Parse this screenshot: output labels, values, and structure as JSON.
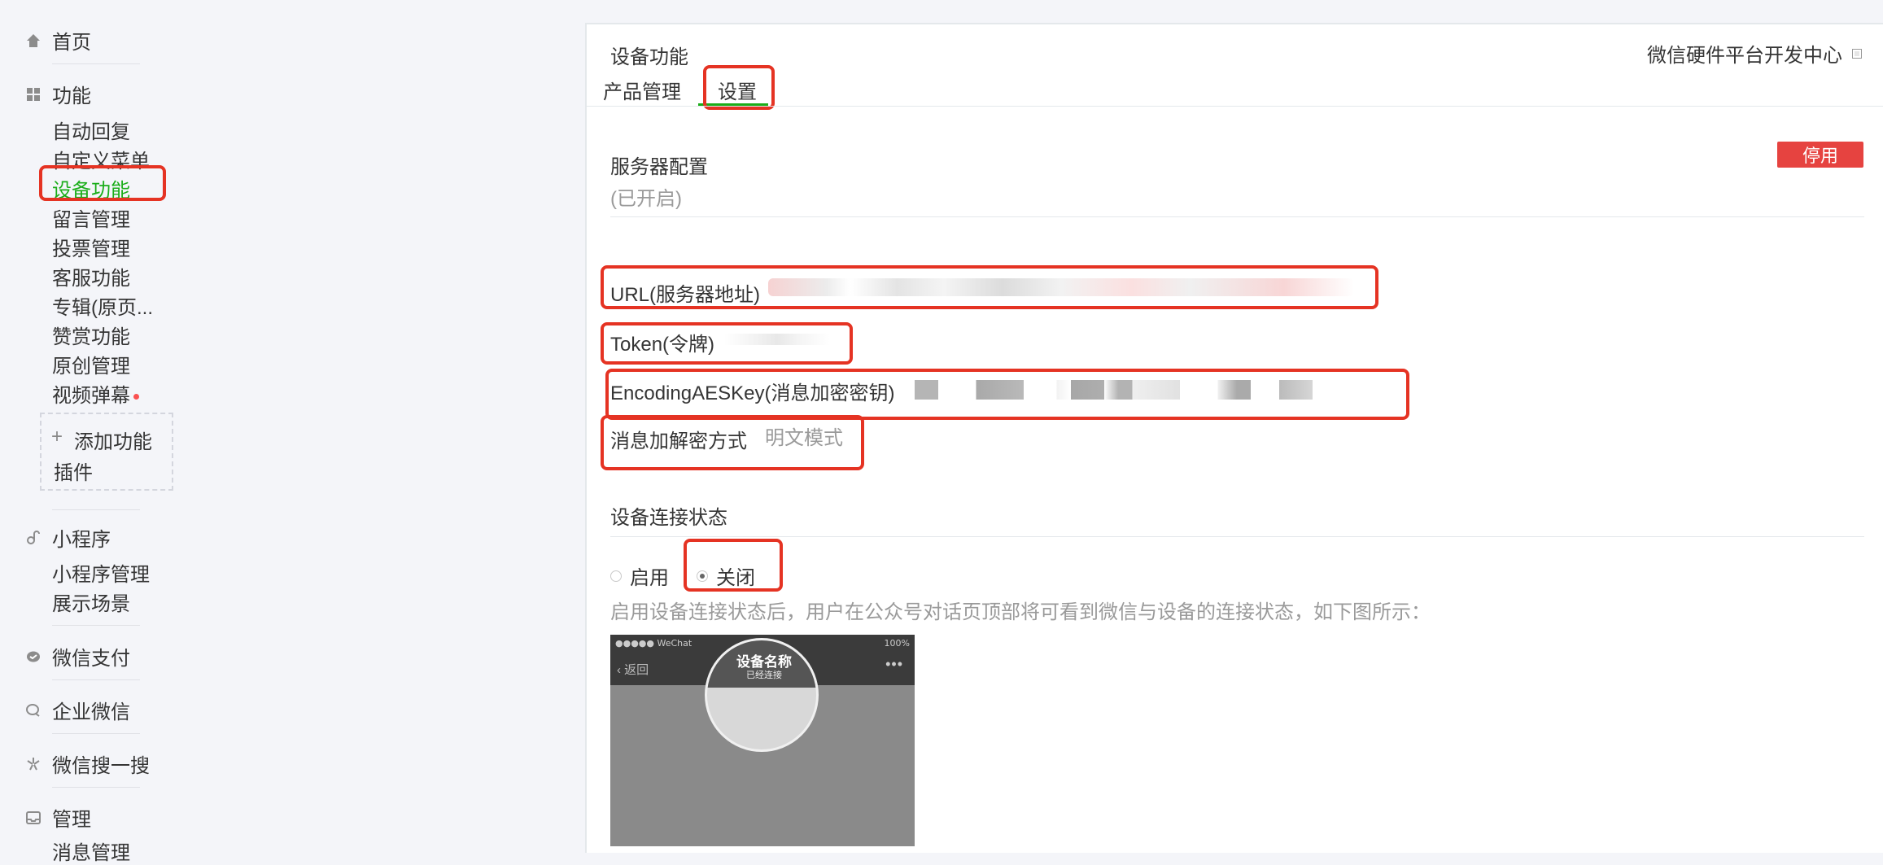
{
  "sidebar": {
    "home": "首页",
    "features": {
      "title": "功能",
      "items": [
        "自动回复",
        "自定义菜单",
        "设备功能",
        "留言管理",
        "投票管理",
        "客服功能",
        "专辑(原页...",
        "赞赏功能",
        "原创管理",
        "视频弹幕"
      ],
      "active_index": 2,
      "add_plugin": [
        "添加功能",
        "插件"
      ]
    },
    "miniprogram": {
      "title": "小程序",
      "items": [
        "小程序管理",
        "展示场景"
      ]
    },
    "wechat_pay": "微信支付",
    "enterprise_wechat": "企业微信",
    "wechat_search": "微信搜一搜",
    "manage": {
      "title": "管理",
      "items": [
        "消息管理"
      ]
    }
  },
  "page": {
    "title": "设备功能",
    "dev_center_link": "微信硬件平台开发中心",
    "tabs": [
      "产品管理",
      "设置"
    ],
    "active_tab": 1
  },
  "server_config": {
    "title": "服务器配置",
    "status": "(已开启)",
    "disable_button": "停用",
    "url_label": "URL(服务器地址)",
    "token_label": "Token(令牌)",
    "aes_label": "EncodingAESKey(消息加密密钥)",
    "encrypt_label": "消息加解密方式",
    "encrypt_value": "明文模式"
  },
  "connection_status": {
    "title": "设备连接状态",
    "options": [
      "启用",
      "关闭"
    ],
    "selected": 1,
    "description": "启用设备连接状态后，用户在公众号对话页顶部将可看到微信与设备的连接状态，如下图所示："
  },
  "demo_image": {
    "carrier": "●●●●● WeChat",
    "battery": "100%",
    "back": "返回",
    "more": "•••",
    "device_name": "设备名称",
    "device_status": "已经连接"
  },
  "colors": {
    "accent_green": "#1aad19",
    "highlight_red": "#e53323",
    "stop_button": "#e64340"
  }
}
